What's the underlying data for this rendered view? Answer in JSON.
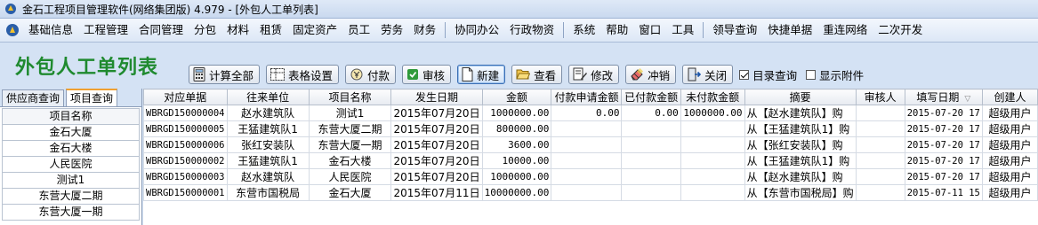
{
  "window": {
    "title": "金石工程项目管理软件(网络集团版) 4.979 - [外包人工单列表]"
  },
  "menu": {
    "items": [
      "基础信息",
      "工程管理",
      "合同管理",
      "分包",
      "材料",
      "租赁",
      "固定资产",
      "员工",
      "劳务",
      "财务",
      "协同办公",
      "行政物资",
      "系统",
      "帮助",
      "窗口",
      "工具",
      "领导查询",
      "快捷单据",
      "重连网络",
      "二次开发"
    ]
  },
  "page": {
    "title": "外包人工单列表"
  },
  "toolbar": {
    "calc_all": "计算全部",
    "table_settings": "表格设置",
    "pay": "付款",
    "review": "审核",
    "new": "新建",
    "view": "查看",
    "edit": "修改",
    "write_off": "冲销",
    "close": "关闭",
    "catalog_query": "目录查询",
    "show_attachments": "显示附件"
  },
  "left_panel": {
    "tabs": [
      "供应商查询",
      "项目查询"
    ],
    "header": "项目名称",
    "items": [
      "金石大厦",
      "金石大楼",
      "人民医院",
      "测试1",
      "东营大厦二期",
      "东营大厦一期"
    ]
  },
  "grid": {
    "columns": [
      "对应单据",
      "往来单位",
      "项目名称",
      "发生日期",
      "金额",
      "付款申请金额",
      "已付款金额",
      "未付款金额",
      "摘要",
      "审核人",
      "填写日期",
      "创建人"
    ],
    "rows": [
      [
        "WBRGD150000004",
        "赵水建筑队",
        "测试1",
        "2015年07月20日",
        "1000000.00",
        "0.00",
        "0.00",
        "1000000.00",
        "从【赵水建筑队】购",
        "",
        "2015-07-20 17",
        "超级用户"
      ],
      [
        "WBRGD150000005",
        "王猛建筑队1",
        "东营大厦二期",
        "2015年07月20日",
        "800000.00",
        "",
        "",
        "",
        "从【王猛建筑队1】购",
        "",
        "2015-07-20 17",
        "超级用户"
      ],
      [
        "WBRGD150000006",
        "张红安装队",
        "东营大厦一期",
        "2015年07月20日",
        "3600.00",
        "",
        "",
        "",
        "从【张红安装队】购",
        "",
        "2015-07-20 17",
        "超级用户"
      ],
      [
        "WBRGD150000002",
        "王猛建筑队1",
        "金石大楼",
        "2015年07月20日",
        "10000.00",
        "",
        "",
        "",
        "从【王猛建筑队1】购",
        "",
        "2015-07-20 17",
        "超级用户"
      ],
      [
        "WBRGD150000003",
        "赵水建筑队",
        "人民医院",
        "2015年07月20日",
        "1000000.00",
        "",
        "",
        "",
        "从【赵水建筑队】购",
        "",
        "2015-07-20 17",
        "超级用户"
      ],
      [
        "WBRGD150000001",
        "东营市国税局",
        "金石大厦",
        "2015年07月11日",
        "10000000.00",
        "",
        "",
        "",
        "从【东营市国税局】购",
        "",
        "2015-07-11 15",
        "超级用户"
      ]
    ]
  }
}
